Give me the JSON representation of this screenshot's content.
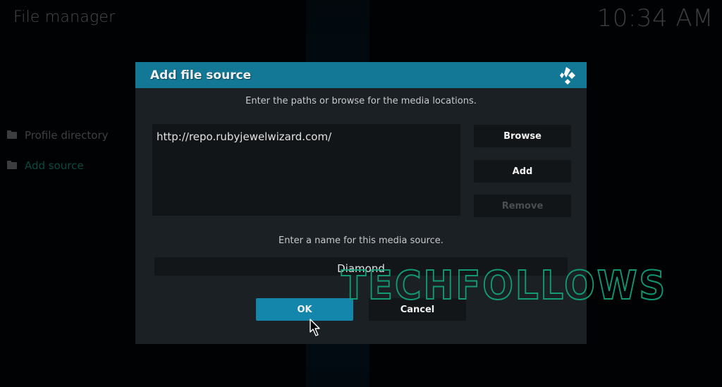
{
  "window": {
    "title": "File manager",
    "clock": "10:34 AM"
  },
  "sidebar": {
    "items": [
      {
        "label": "Profile directory",
        "icon": "folder-icon",
        "active": false
      },
      {
        "label": "Add source",
        "icon": "folder-icon",
        "active": true
      }
    ]
  },
  "dialog": {
    "title": "Add file source",
    "logo": "kodi-logo-icon",
    "instruction_paths": "Enter the paths or browse for the media locations.",
    "paths": [
      "http://repo.rubyjewelwizard.com/"
    ],
    "buttons": {
      "browse": "Browse",
      "add": "Add",
      "remove": "Remove"
    },
    "instruction_name": "Enter a name for this media source.",
    "name_value": "Diamond",
    "ok": "OK",
    "cancel": "Cancel"
  },
  "watermark": "TECHFOLLOWS",
  "colors": {
    "header": "#137895",
    "ok_button": "#1485ab",
    "dialog_bg": "#1b2024",
    "watermark": "#12a57c"
  }
}
